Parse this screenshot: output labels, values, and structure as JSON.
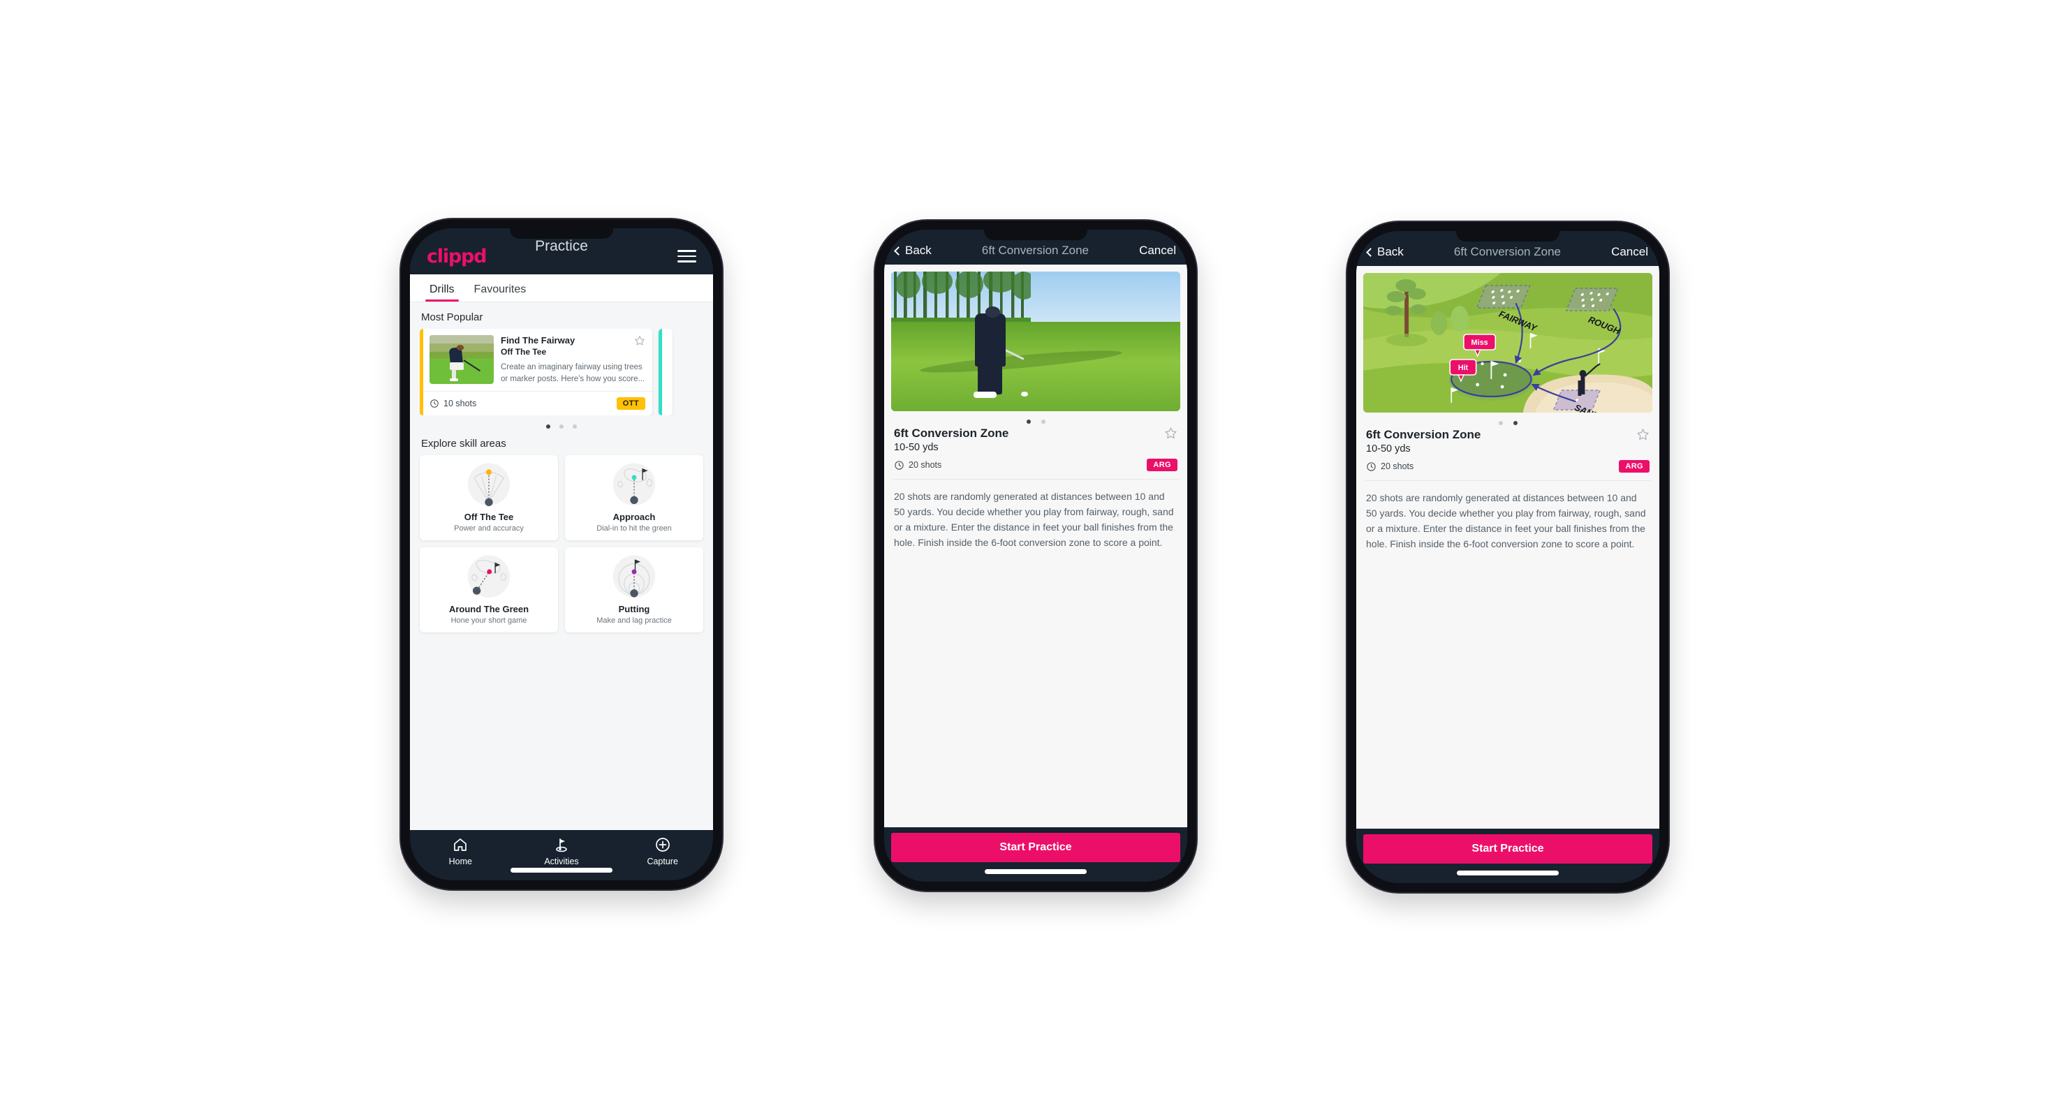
{
  "brand": {
    "logo_text": "clippd",
    "accent_pink": "#EC0F69",
    "accent_yellow": "#FFC107",
    "accent_teal": "#2FE0C8",
    "dark_navy": "#17222E"
  },
  "phone1": {
    "appbar": {
      "logo": "clippd",
      "title": "Practice",
      "menu_icon": "hamburger-icon"
    },
    "tabs": [
      {
        "label": "Drills",
        "active": true
      },
      {
        "label": "Favourites",
        "active": false
      }
    ],
    "sections": {
      "most_popular_title": "Most Popular",
      "explore_title": "Explore skill areas"
    },
    "drill_card": {
      "title": "Find The Fairway",
      "subtitle": "Off The Tee",
      "description": "Create an imaginary fairway using trees or marker posts. Here's how you score...",
      "shots": "10 shots",
      "badge": "OTT",
      "badge_color": "#FFC107",
      "accent_color": "#FFC107",
      "favourite_icon": "star-outline-icon",
      "shots_icon": "clock-icon"
    },
    "carousel_dots": {
      "count": 3,
      "active_index": 0
    },
    "skill_areas": [
      {
        "name": "Off The Tee",
        "desc": "Power and accuracy",
        "icon": "tee-fan-icon",
        "dot_color": "#FFB300"
      },
      {
        "name": "Approach",
        "desc": "Dial-in to hit the green",
        "icon": "green-approach-icon",
        "dot_color": "#2FE0C8"
      },
      {
        "name": "Around The Green",
        "desc": "Hone your short game",
        "icon": "chip-green-icon",
        "dot_color": "#EC0F69"
      },
      {
        "name": "Putting",
        "desc": "Make and lag practice",
        "icon": "putting-rings-icon",
        "dot_color": "#9C27B0"
      }
    ],
    "bottom_nav": [
      {
        "label": "Home",
        "icon": "home-icon",
        "active": false
      },
      {
        "label": "Activities",
        "icon": "golf-flag-icon",
        "active": true
      },
      {
        "label": "Capture",
        "icon": "plus-circle-icon",
        "active": false
      }
    ]
  },
  "phone2": {
    "appbar": {
      "back": "Back",
      "title": "6ft Conversion Zone",
      "cancel": "Cancel",
      "back_icon": "chevron-left-icon"
    },
    "media": {
      "kind": "video-still",
      "alt": "golfer chipping on fairway"
    },
    "carousel_dots": {
      "count": 2,
      "active_index": 0
    },
    "detail": {
      "name": "6ft Conversion Zone",
      "yards": "10-50 yds",
      "shots": "20 shots",
      "badge": "ARG",
      "badge_color": "#EC0F69",
      "favourite_icon": "star-outline-icon",
      "shots_icon": "clock-icon",
      "description": "20 shots are randomly generated at distances between 10 and 50 yards. You decide whether you play from fairway, rough, sand or a mixture. Enter the distance in feet your ball finishes from the hole. Finish inside the 6-foot conversion zone to score a point."
    },
    "cta": "Start Practice"
  },
  "phone3": {
    "appbar": {
      "back": "Back",
      "title": "6ft Conversion Zone",
      "cancel": "Cancel",
      "back_icon": "chevron-left-icon"
    },
    "media": {
      "kind": "course-illustration",
      "labels": {
        "fairway": "FAIRWAY",
        "rough": "ROUGH",
        "sand": "SAND",
        "miss": "Miss",
        "hit": "Hit"
      }
    },
    "carousel_dots": {
      "count": 2,
      "active_index": 1
    },
    "detail": {
      "name": "6ft Conversion Zone",
      "yards": "10-50 yds",
      "shots": "20 shots",
      "badge": "ARG",
      "badge_color": "#EC0F69",
      "favourite_icon": "star-outline-icon",
      "shots_icon": "clock-icon",
      "description": "20 shots are randomly generated at distances between 10 and 50 yards. You decide whether you play from fairway, rough, sand or a mixture. Enter the distance in feet your ball finishes from the hole. Finish inside the 6-foot conversion zone to score a point."
    },
    "cta": "Start Practice"
  }
}
